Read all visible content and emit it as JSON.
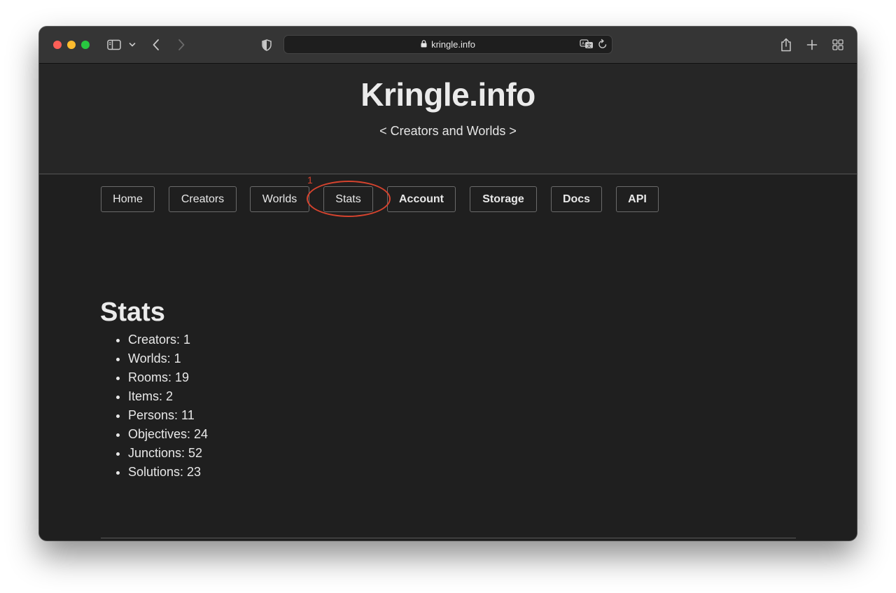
{
  "browser": {
    "url": "kringle.info"
  },
  "site": {
    "title": "Kringle.info",
    "tagline": "< Creators and Worlds >"
  },
  "nav": {
    "items": [
      {
        "label": "Home"
      },
      {
        "label": "Creators"
      },
      {
        "label": "Worlds"
      },
      {
        "label": "Stats"
      },
      {
        "label": "Account"
      },
      {
        "label": "Storage"
      },
      {
        "label": "Docs"
      },
      {
        "label": "API"
      }
    ]
  },
  "annotation": {
    "number": "1",
    "color": "#d5432e"
  },
  "stats": {
    "heading": "Stats",
    "items": [
      "Creators: 1",
      "Worlds: 1",
      "Rooms: 19",
      "Items: 2",
      "Persons: 11",
      "Objectives: 24",
      "Junctions: 52",
      "Solutions: 23"
    ]
  },
  "colors": {
    "toolbar": "#353535",
    "page_background": "#1f1f1f",
    "header_background": "#262626"
  }
}
